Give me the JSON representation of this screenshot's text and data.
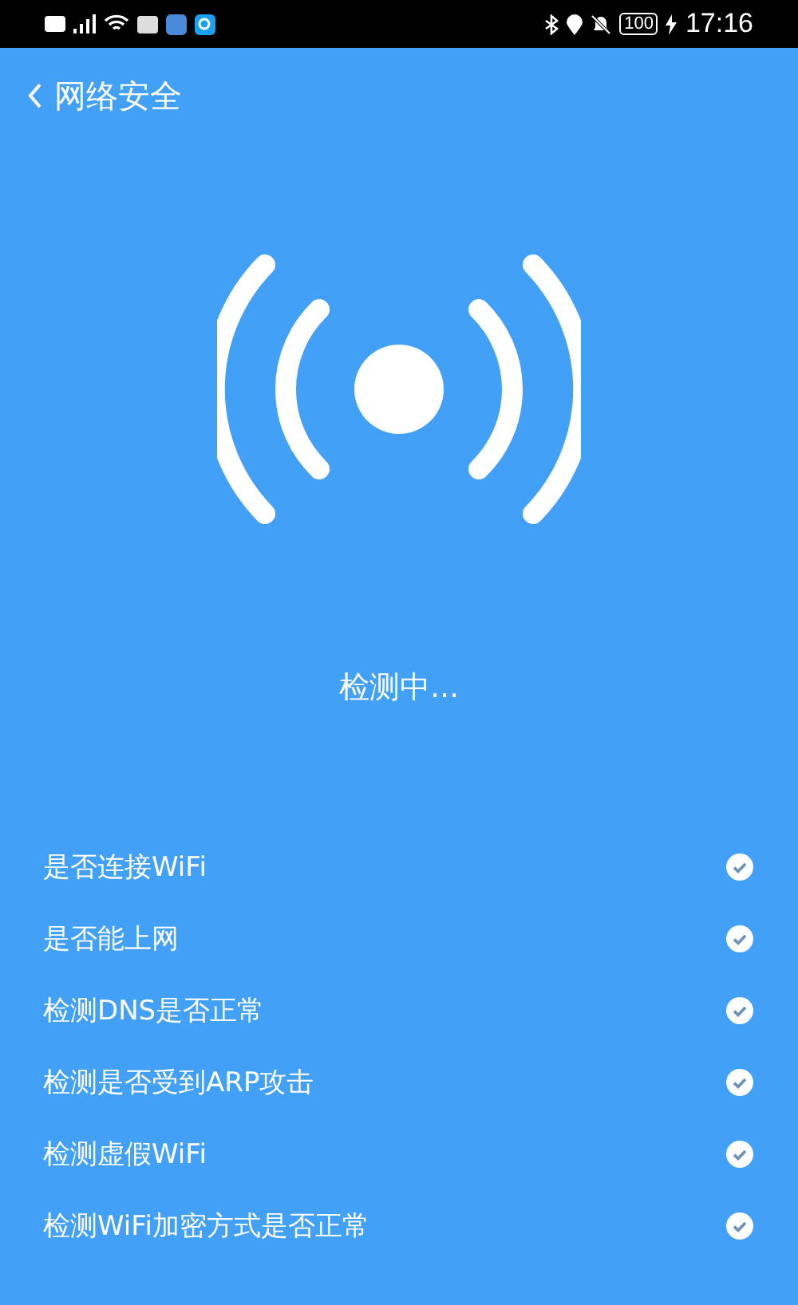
{
  "status_bar": {
    "battery": "100",
    "time": "17:16"
  },
  "header": {
    "title": "网络安全"
  },
  "scan": {
    "status": "检测中..."
  },
  "checks": [
    {
      "label": "是否连接WiFi",
      "checked": true
    },
    {
      "label": "是否能上网",
      "checked": true
    },
    {
      "label": "检测DNS是否正常",
      "checked": true
    },
    {
      "label": "检测是否受到ARP攻击",
      "checked": true
    },
    {
      "label": "检测虚假WiFi",
      "checked": true
    },
    {
      "label": "检测WiFi加密方式是否正常",
      "checked": true
    }
  ]
}
